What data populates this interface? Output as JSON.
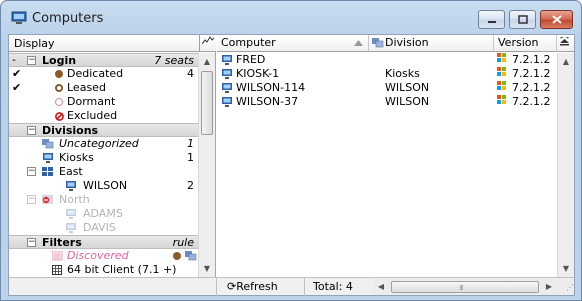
{
  "window": {
    "title": "Computers"
  },
  "left_pane": {
    "header_label": "Display",
    "tree": [
      {
        "kind": "group",
        "label": "Login",
        "right": "7 seats",
        "expanded": true
      },
      {
        "kind": "item",
        "label": "Dedicated",
        "count": "4",
        "checked": true,
        "dot": "filled-brown"
      },
      {
        "kind": "item",
        "label": "Leased",
        "count": "",
        "checked": true,
        "dot": "ring-brown"
      },
      {
        "kind": "item",
        "label": "Dormant",
        "count": "",
        "checked": false,
        "dot": "ring-pink"
      },
      {
        "kind": "item",
        "label": "Excluded",
        "count": "",
        "checked": false,
        "dot": "no-red"
      },
      {
        "kind": "group",
        "label": "Divisions",
        "right": "",
        "expanded": true
      },
      {
        "kind": "item",
        "label": "Uncategorized",
        "count": "1",
        "italic": true
      },
      {
        "kind": "item",
        "label": "Kiosks",
        "count": "1"
      },
      {
        "kind": "item",
        "label": "East",
        "count": "",
        "expandable": true
      },
      {
        "kind": "item",
        "label": "WILSON",
        "count": "2",
        "indent": 2
      },
      {
        "kind": "item",
        "label": "North",
        "count": "",
        "expandable": true,
        "muted": true
      },
      {
        "kind": "item",
        "label": "ADAMS",
        "count": "",
        "indent": 2,
        "muted": true
      },
      {
        "kind": "item",
        "label": "DAVIS",
        "count": "",
        "indent": 2,
        "muted": true
      },
      {
        "kind": "group",
        "label": "Filters",
        "right": "rule",
        "expanded": true
      },
      {
        "kind": "item",
        "label": "Discovered",
        "count": "",
        "pink": true
      },
      {
        "kind": "item",
        "label": "64 bit Client (7.1 +)",
        "count": ""
      }
    ]
  },
  "table": {
    "columns": [
      "Computer",
      "Division",
      "Version"
    ],
    "rows": [
      {
        "computer": "FRED",
        "division": "",
        "version": "7.2.1.2"
      },
      {
        "computer": "KIOSK-1",
        "division": "Kiosks",
        "version": "7.2.1.2"
      },
      {
        "computer": "WILSON-114",
        "division": "WILSON",
        "version": "7.2.1.2"
      },
      {
        "computer": "WILSON-37",
        "division": "WILSON",
        "version": "7.2.1.2"
      }
    ]
  },
  "footer": {
    "refresh_label": "Refresh",
    "total_label": "Total: 4"
  },
  "colors": {
    "win_red": "#f25022",
    "win_green": "#7fba00",
    "win_blue": "#00a4ef",
    "win_yellow": "#ffb900",
    "pc_blue": "#2f5fa8"
  },
  "icons": {
    "app": "computer-icon",
    "sort": "sort-ascending-icon",
    "refresh": "refresh-icon"
  }
}
